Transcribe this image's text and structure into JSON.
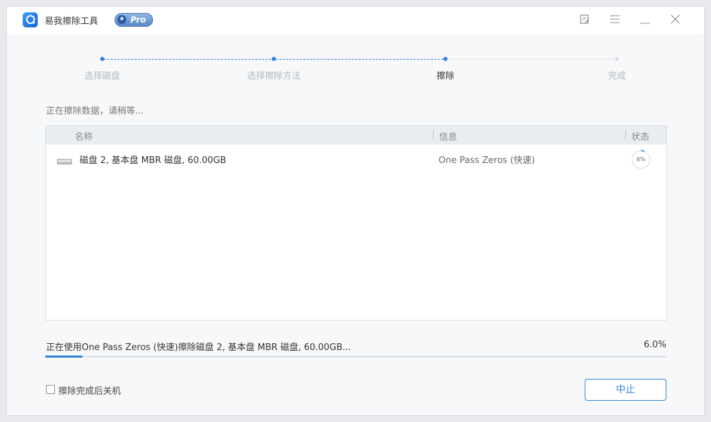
{
  "app": {
    "title": "易我擦除工具",
    "badge": "Pro"
  },
  "window_controls": {
    "feedback_icon": "edit-note-icon",
    "menu_icon": "hamburger-menu-icon",
    "minimize_icon": "minimize-icon",
    "close_icon": "close-icon"
  },
  "steps": [
    {
      "label": "选择磁盘",
      "state": "done"
    },
    {
      "label": "选择擦除方法",
      "state": "done"
    },
    {
      "label": "擦除",
      "state": "active"
    },
    {
      "label": "完成",
      "state": "pending"
    }
  ],
  "status_text": "正在擦除数据，请稍等...",
  "table": {
    "headers": {
      "name": "名称",
      "info": "信息",
      "status": "状态"
    },
    "rows": [
      {
        "name": "磁盘 2, 基本盘 MBR 磁盘, 60.00GB",
        "info": "One Pass Zeros (快速)",
        "progress_label": "6%",
        "progress": 0.06
      }
    ]
  },
  "operation": {
    "text": "正在使用One Pass Zeros (快速)擦除磁盘 2, 基本盘 MBR 磁盘, 60.00GB...",
    "percent_label": "6.0%",
    "progress": 0.06
  },
  "shutdown_checkbox": {
    "label": "擦除完成后关机",
    "checked": false
  },
  "stop_button": {
    "label": "中止"
  },
  "colors": {
    "accent": "#2f7fe0",
    "inactive": "#dcdfe3"
  }
}
